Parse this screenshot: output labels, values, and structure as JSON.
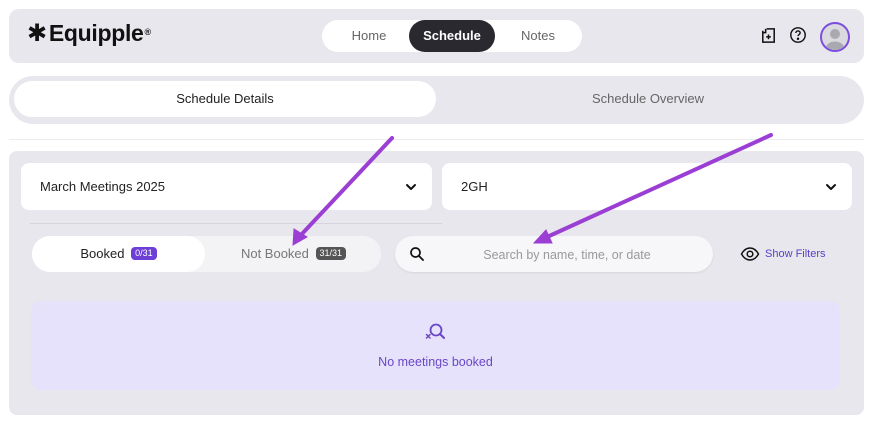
{
  "brand": {
    "name": "Equipple",
    "symbol": "✱",
    "trademark": "®"
  },
  "nav": {
    "items": [
      {
        "label": "Home"
      },
      {
        "label": "Schedule"
      },
      {
        "label": "Notes"
      }
    ],
    "active": "Schedule"
  },
  "header_icons": [
    "add-document-icon",
    "help-icon",
    "avatar"
  ],
  "tabs": [
    {
      "label": "Schedule Details"
    },
    {
      "label": "Schedule Overview"
    }
  ],
  "selects": {
    "event": {
      "value": "March Meetings 2025"
    },
    "group": {
      "value": "2GH"
    }
  },
  "toggle": {
    "booked": {
      "label": "Booked",
      "count": "0/31"
    },
    "not_booked": {
      "label": "Not Booked",
      "count": "31/31"
    }
  },
  "search": {
    "placeholder": "Search by name, time, or date",
    "value": ""
  },
  "filters": {
    "label": "Show Filters"
  },
  "empty_state": {
    "text": "No meetings booked"
  },
  "colors": {
    "accent": "#6d3fd6",
    "annotation_arrow": "#9b3fd4",
    "dark_pill": "#2a2930",
    "panel_bg": "#e8e7ed"
  }
}
